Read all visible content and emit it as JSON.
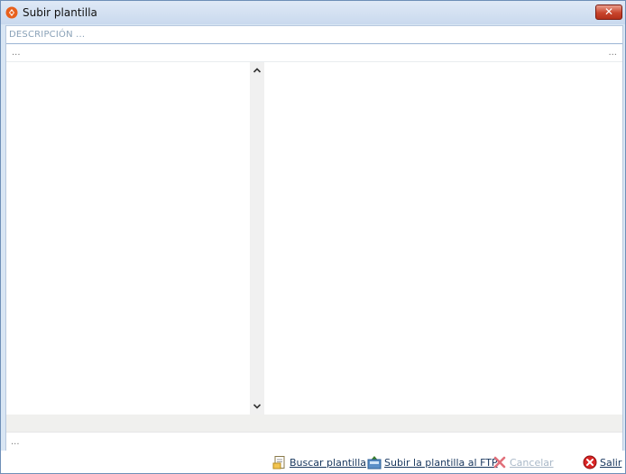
{
  "window": {
    "title": "Subir plantilla",
    "close_label": "✕"
  },
  "description": {
    "placeholder": "DESCRIPCIÓN ..."
  },
  "path_row": {
    "left": "...",
    "right": "..."
  },
  "bottom_row": {
    "text": "..."
  },
  "footer": {
    "browse_label": "Buscar plantilla",
    "upload_label": "Subir la plantilla al FTP",
    "cancel_label": "Cancelar",
    "exit_label": "Salir"
  },
  "colors": {
    "accent": "#17365d",
    "disabled": "#a9b8c8",
    "close_button": "#c9442c"
  }
}
